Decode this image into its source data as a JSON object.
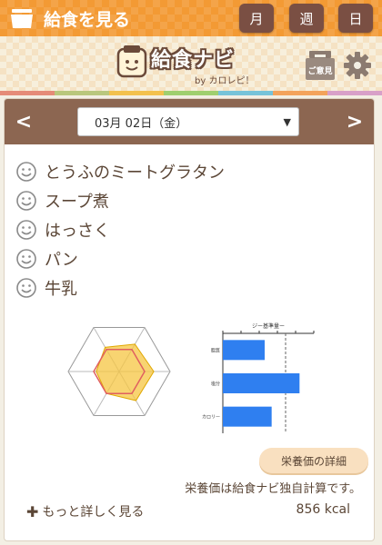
{
  "app": {
    "title": "給食を見る",
    "period_buttons": [
      "月",
      "週",
      "日"
    ]
  },
  "header": {
    "logo_title": "給食ナビ",
    "logo_sub": "by カロレピ！",
    "opinion_label": "ご意見",
    "colors": [
      "#e58b78",
      "#b9c77d",
      "#f2c14e",
      "#9fcf6f",
      "#76c3d9",
      "#f3a35c",
      "#d8a0c8"
    ]
  },
  "date": {
    "selected": "03月 02日（金）",
    "prev": "<",
    "next": ">"
  },
  "menu": {
    "items": [
      {
        "name": "とうふのミートグラタン",
        "icon": "smile-icon"
      },
      {
        "name": "スープ煮",
        "icon": "smile-icon"
      },
      {
        "name": "はっさく",
        "icon": "smile-icon"
      },
      {
        "name": "パン",
        "icon": "smile-icon"
      },
      {
        "name": "牛乳",
        "icon": "smile-icon"
      }
    ]
  },
  "nutrition": {
    "bar_chart_title": "ジー基準量ー",
    "detail_button": "栄養価の詳細",
    "note": "栄養価は給食ナビ独自計算です。",
    "more_link": "もっと詳しく見る",
    "kcal": "856 kcal"
  },
  "chart_data": [
    {
      "type": "radar",
      "axes": 6,
      "series": [
        {
          "values": [
            0.5,
            0.5,
            0.5,
            0.5,
            0.5,
            0.5
          ],
          "color": "#e06060"
        },
        {
          "values": [
            0.62,
            0.68,
            0.66,
            0.5,
            0.45,
            0.55
          ],
          "color": "#f5c542"
        }
      ]
    },
    {
      "type": "bar",
      "title": "ジー基準量ー",
      "categories": [
        "脂質",
        "塩分",
        "カロリー"
      ],
      "values": [
        0.6,
        1.1,
        0.7
      ],
      "reference": 0.9,
      "color": "#2f7ff0"
    }
  ]
}
